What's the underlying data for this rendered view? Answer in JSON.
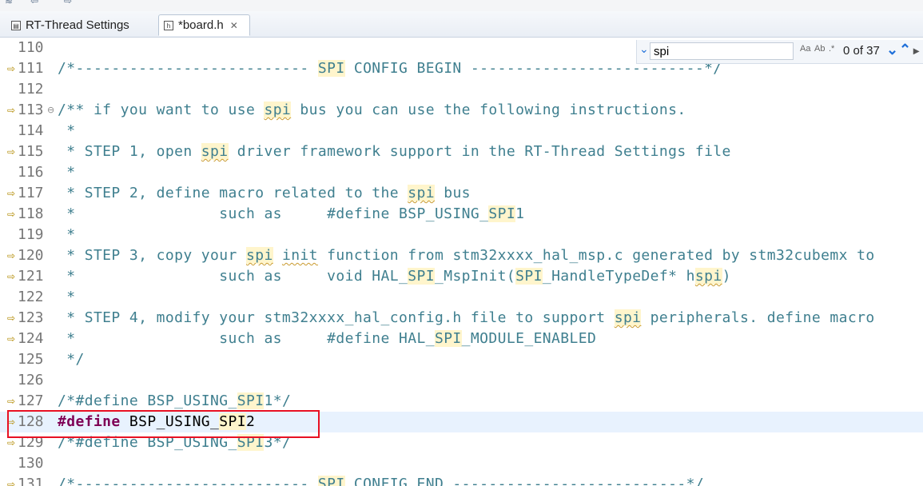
{
  "tabs": [
    {
      "label": "RT-Thread Settings",
      "active": false
    },
    {
      "label": "*board.h",
      "active": true
    }
  ],
  "find": {
    "value": "spi",
    "match_count": "0 of 37"
  },
  "lines": [
    {
      "num": "110",
      "marker": false,
      "text": ""
    },
    {
      "num": "111",
      "marker": true,
      "text": "/*-------------------------- SPI CONFIG BEGIN --------------------------*/"
    },
    {
      "num": "112",
      "marker": false,
      "text": ""
    },
    {
      "num": "113",
      "marker": true,
      "text": "/** if you want to use spi bus you can use the following instructions."
    },
    {
      "num": "114",
      "marker": false,
      "text": " *"
    },
    {
      "num": "115",
      "marker": true,
      "text": " * STEP 1, open spi driver framework support in the RT-Thread Settings file"
    },
    {
      "num": "116",
      "marker": false,
      "text": " *"
    },
    {
      "num": "117",
      "marker": true,
      "text": " * STEP 2, define macro related to the spi bus"
    },
    {
      "num": "118",
      "marker": true,
      "text": " *                such as     #define BSP_USING_SPI1"
    },
    {
      "num": "119",
      "marker": false,
      "text": " *"
    },
    {
      "num": "120",
      "marker": true,
      "text": " * STEP 3, copy your spi init function from stm32xxxx_hal_msp.c generated by stm32cubemx to"
    },
    {
      "num": "121",
      "marker": true,
      "text": " *                such as     void HAL_SPI_MspInit(SPI_HandleTypeDef* hspi)"
    },
    {
      "num": "122",
      "marker": false,
      "text": " *"
    },
    {
      "num": "123",
      "marker": true,
      "text": " * STEP 4, modify your stm32xxxx_hal_config.h file to support spi peripherals. define macro"
    },
    {
      "num": "124",
      "marker": true,
      "text": " *                such as     #define HAL_SPI_MODULE_ENABLED"
    },
    {
      "num": "125",
      "marker": false,
      "text": " */"
    },
    {
      "num": "126",
      "marker": false,
      "text": ""
    },
    {
      "num": "127",
      "marker": true,
      "text": "/*#define BSP_USING_SPI1*/"
    },
    {
      "num": "128",
      "marker": true,
      "text": "#define BSP_USING_SPI2"
    },
    {
      "num": "129",
      "marker": true,
      "text": "/*#define BSP_USING_SPI3*/"
    },
    {
      "num": "130",
      "marker": false,
      "text": ""
    },
    {
      "num": "131",
      "marker": true,
      "text": "/*-------------------------- SPI CONFIG END --------------------------*/"
    }
  ],
  "current_line": "128",
  "colors": {
    "comment": "#3f7f8f",
    "keyword": "#7f0055",
    "search_match": "#fff5cc",
    "callout": "#e81123"
  }
}
